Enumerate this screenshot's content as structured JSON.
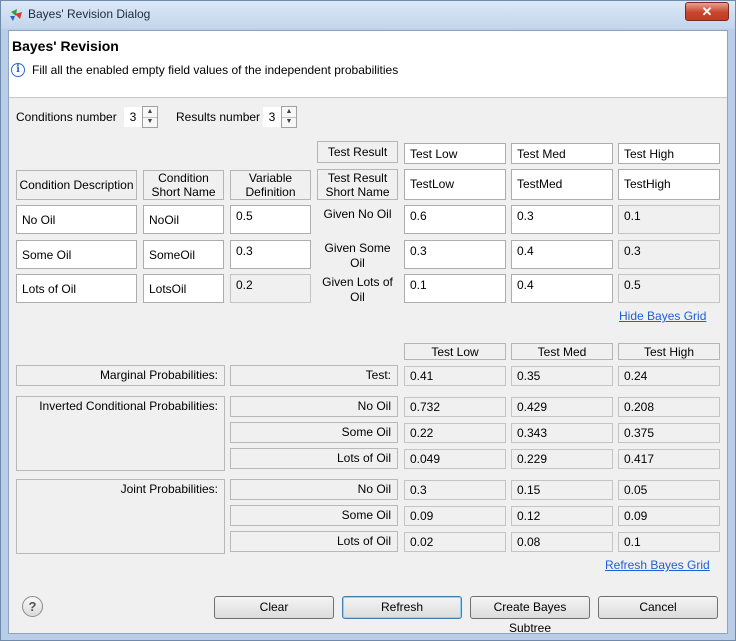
{
  "window": {
    "title": "Bayes' Revision Dialog",
    "close_label": "✕"
  },
  "header": {
    "title": "Bayes' Revision",
    "message": "Fill all the enabled empty field values of the independent probabilities"
  },
  "counts": {
    "conditions_label": "Conditions number",
    "conditions_value": "3",
    "results_label": "Results number",
    "results_value": "3"
  },
  "grid": {
    "test_result_label": "Test Result",
    "short_name_label": "Test Result Short Name",
    "test_results": [
      "Test Low",
      "Test Med",
      "Test High"
    ],
    "test_short_names": [
      "TestLow",
      "TestMed",
      "TestHigh"
    ],
    "col_headers": [
      "Condition Description",
      "Condition Short Name",
      "Variable Definition"
    ],
    "conditions": [
      {
        "description": "No Oil",
        "short": "NoOil",
        "prob": "0.5",
        "given": "Given No Oil",
        "values": [
          "0.6",
          "0.3",
          "0.1"
        ]
      },
      {
        "description": "Some Oil",
        "short": "SomeOil",
        "prob": "0.3",
        "given": "Given Some Oil",
        "values": [
          "0.3",
          "0.4",
          "0.3"
        ]
      },
      {
        "description": "Lots of Oil",
        "short": "LotsOil",
        "prob": "0.2",
        "given": "Given Lots of Oil",
        "values": [
          "0.1",
          "0.4",
          "0.5"
        ]
      }
    ],
    "hide_link": "Hide Bayes Grid"
  },
  "results": {
    "headers": [
      "Test Low",
      "Test Med",
      "Test High"
    ],
    "marginal_label": "Marginal Probabilities:",
    "marginal_row_label": "Test:",
    "marginal": [
      "0.41",
      "0.35",
      "0.24"
    ],
    "inverted_label": "Inverted Conditional Probabilities:",
    "inverted": [
      {
        "label": "No Oil",
        "values": [
          "0.732",
          "0.429",
          "0.208"
        ]
      },
      {
        "label": "Some Oil",
        "values": [
          "0.22",
          "0.343",
          "0.375"
        ]
      },
      {
        "label": "Lots of Oil",
        "values": [
          "0.049",
          "0.229",
          "0.417"
        ]
      }
    ],
    "joint_label": "Joint Probabilities:",
    "joint": [
      {
        "label": "No Oil",
        "values": [
          "0.3",
          "0.15",
          "0.05"
        ]
      },
      {
        "label": "Some Oil",
        "values": [
          "0.09",
          "0.12",
          "0.09"
        ]
      },
      {
        "label": "Lots of Oil",
        "values": [
          "0.02",
          "0.08",
          "0.1"
        ]
      }
    ],
    "refresh_link": "Refresh Bayes Grid"
  },
  "buttons": {
    "clear": "Clear",
    "refresh": "Refresh",
    "create": "Create Bayes Subtree",
    "cancel": "Cancel",
    "help": "?"
  },
  "colors": {
    "link": "#1f5fd6",
    "close": "#c8452d"
  }
}
